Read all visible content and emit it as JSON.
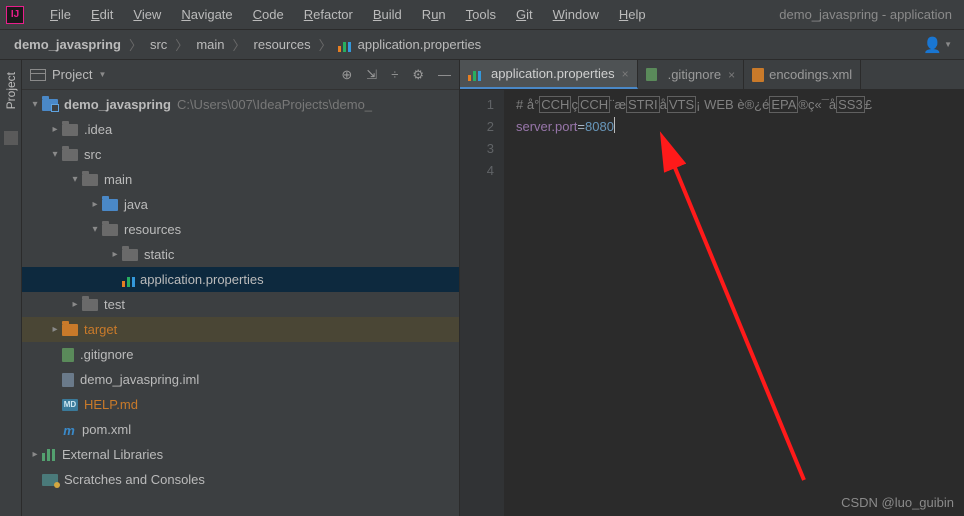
{
  "menubar": {
    "items": [
      "File",
      "Edit",
      "View",
      "Navigate",
      "Code",
      "Refactor",
      "Build",
      "Run",
      "Tools",
      "Git",
      "Window",
      "Help"
    ],
    "window_title": "demo_javaspring - application"
  },
  "breadcrumbs": {
    "items": [
      "demo_javaspring",
      "src",
      "main",
      "resources",
      "application.properties"
    ]
  },
  "project_panel": {
    "title": "Project",
    "tree": {
      "root": {
        "name": "demo_javaspring",
        "path": "C:\\Users\\007\\IdeaProjects\\demo_"
      },
      "idea": ".idea",
      "src": "src",
      "main": "main",
      "java": "java",
      "resources": "resources",
      "static": "static",
      "appprops": "application.properties",
      "test": "test",
      "target": "target",
      "gitignore": ".gitignore",
      "iml": "demo_javaspring.iml",
      "help": "HELP.md",
      "pom": "pom.xml",
      "ext": "External Libraries",
      "scratch": "Scratches and Consoles"
    }
  },
  "side_tab": {
    "label": "Project"
  },
  "tabs": [
    {
      "label": "application.properties"
    },
    {
      "label": ".gitignore"
    },
    {
      "label": "encodings.xml"
    }
  ],
  "editor": {
    "gutter": [
      "1",
      "2",
      "3",
      "4"
    ],
    "line1": {
      "prefix": "# å°",
      "b1": "CCH",
      "mid1": "ç",
      "b2": "CCH",
      "mid2": "¨æ",
      "b3": "STRI",
      "mid3": "å",
      "b4": "VTS",
      "mid4": "¡ WEB è®¿é",
      "b5": "EPA",
      "mid5": "®ç«¯å",
      "b6": "SS3",
      "suffix": "£"
    },
    "line2": {
      "key": "server.port",
      "eq": "=",
      "val": "8080"
    }
  },
  "watermark": "CSDN @luo_guibin",
  "md_label": "MD",
  "m_label": "m"
}
